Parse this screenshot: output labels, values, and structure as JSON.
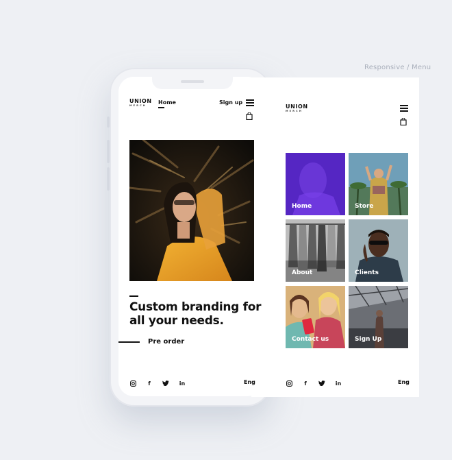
{
  "caption": "Responsive / Menu",
  "brand": {
    "name": "UNION",
    "sub": "MERCH"
  },
  "mobile_home": {
    "nav_active": "Home",
    "signup": "Sign up",
    "headline_line1": "Custom branding for",
    "headline_line2": "all your needs.",
    "cta": "Pre order",
    "lang": "Eng",
    "icons": [
      "instagram-icon",
      "facebook-icon",
      "twitter-icon",
      "linkedin-icon",
      "menu-icon",
      "bag-icon"
    ]
  },
  "menu_screen": {
    "tiles": [
      {
        "label": "Home",
        "overlay": "#6a2cf0"
      },
      {
        "label": "Store"
      },
      {
        "label": "About"
      },
      {
        "label": "Clients"
      },
      {
        "label": "Contact us"
      },
      {
        "label": "Sign Up"
      }
    ],
    "lang": "Eng"
  },
  "colors": {
    "accent": "#6a2cf0",
    "background": "#eef0f4",
    "text": "#111111"
  }
}
